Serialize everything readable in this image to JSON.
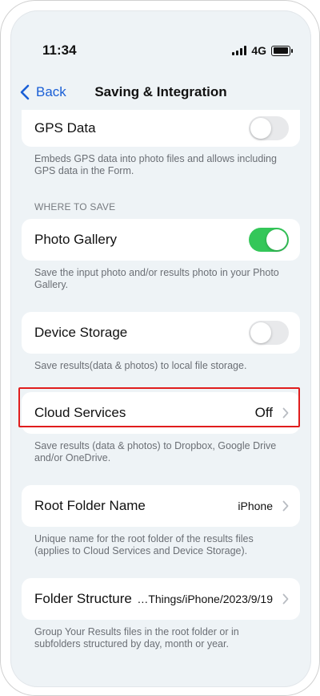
{
  "status": {
    "time": "11:34",
    "network": "4G",
    "battery_level": 0.85,
    "signal_bars": 4
  },
  "nav": {
    "back_label": "Back",
    "title": "Saving & Integration"
  },
  "gps": {
    "label": "GPS Data",
    "enabled": false,
    "description": "Embeds GPS data into photo files and allows including GPS data in the Form."
  },
  "where_to_save": {
    "header": "WHERE TO SAVE"
  },
  "photo_gallery": {
    "label": "Photo Gallery",
    "enabled": true,
    "description": "Save the input photo and/or results photo in your Photo Gallery."
  },
  "device_storage": {
    "label": "Device Storage",
    "enabled": false,
    "description": "Save results(data & photos) to local file storage."
  },
  "cloud_services": {
    "label": "Cloud Services",
    "value": "Off",
    "description": "Save results (data & photos) to Dropbox, Google Drive and/or OneDrive."
  },
  "root_folder": {
    "label": "Root Folder Name",
    "value": "iPhone",
    "description": "Unique name for the root folder of the results files (applies to Cloud Services and Device Storage)."
  },
  "folder_structure": {
    "label": "Folder Structure",
    "value": "…Things/iPhone/2023/9/19",
    "description": "Group Your Results files in the root folder or in subfolders structured by day, month or year."
  },
  "colors": {
    "accent": "#1a5fd6",
    "toggle_on": "#34c759",
    "highlight": "#e01d1d"
  }
}
